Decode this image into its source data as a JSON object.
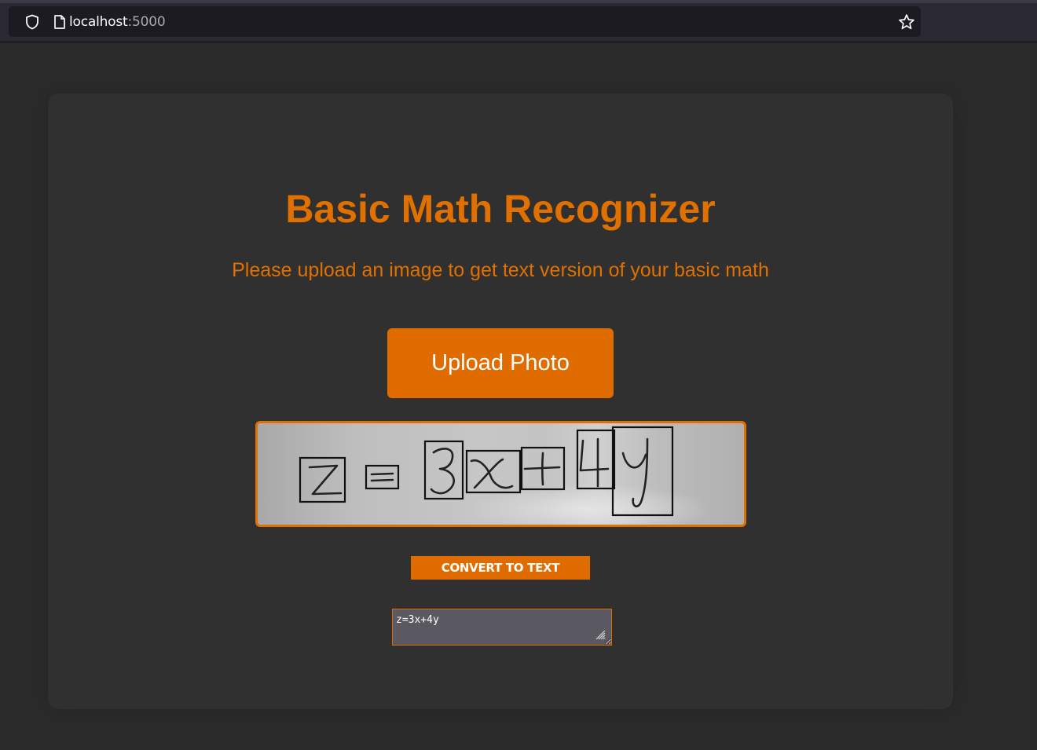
{
  "browser": {
    "url_host": "localhost",
    "url_port": ":5000"
  },
  "page": {
    "title": "Basic Math Recognizer",
    "subtitle": "Please upload an image to get text version of your basic math",
    "upload_label": "Upload Photo",
    "image_content": "z=3x+4y",
    "convert_label": "CONVERT TO TEXT",
    "result_text": "z=3x+4y"
  },
  "colors": {
    "accent": "#e07000",
    "background": "#2b2b2b",
    "card": "#303030",
    "result_bg": "#5a5961"
  }
}
